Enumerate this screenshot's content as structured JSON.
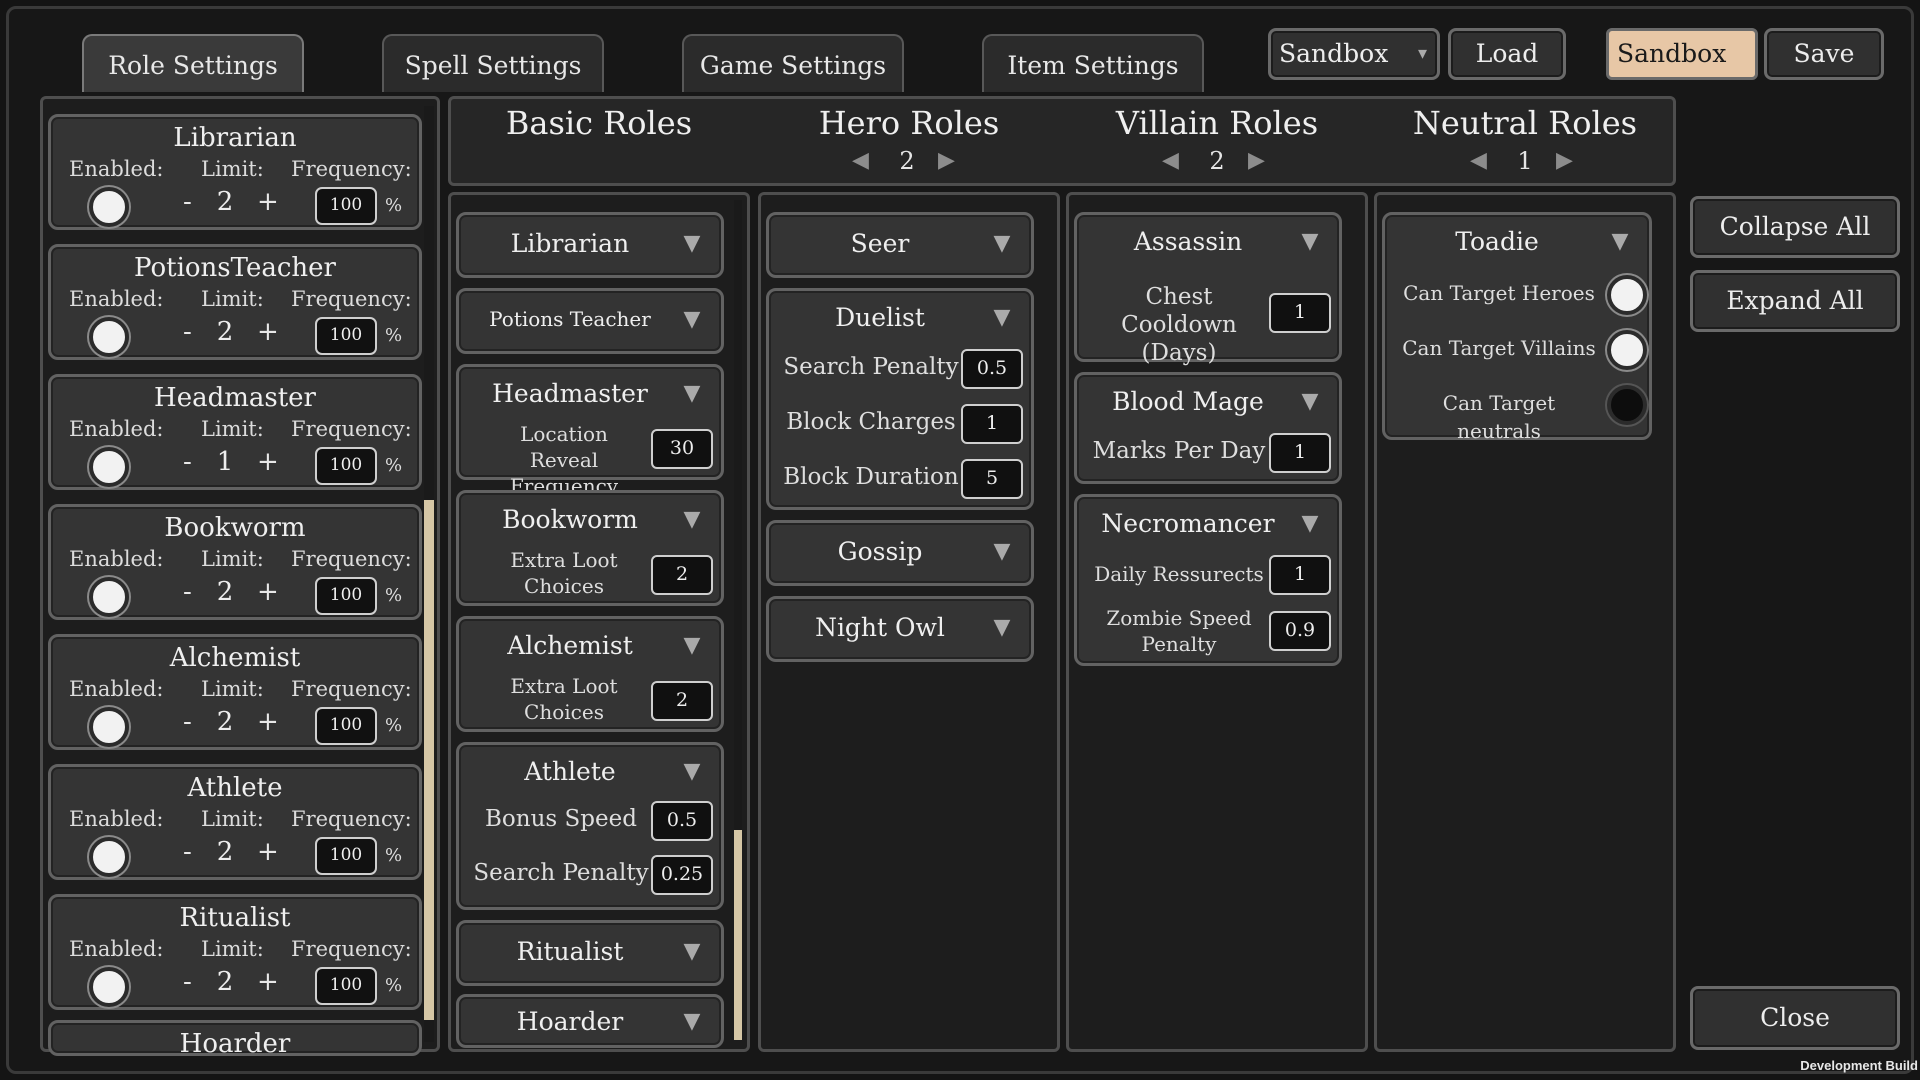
{
  "tabs": [
    "Role Settings",
    "Spell Settings",
    "Game Settings",
    "Item Settings"
  ],
  "top_controls": {
    "preset_dropdown": "Sandbox",
    "load_label": "Load",
    "preset_name_input": "Sandbox",
    "save_label": "Save"
  },
  "left_panel": {
    "labels": {
      "enabled": "Enabled:",
      "limit": "Limit:",
      "frequency": "Frequency:",
      "minus": "-",
      "plus": "+",
      "percent": "%"
    },
    "roles": [
      {
        "name": "Librarian",
        "enabled": true,
        "limit": "2",
        "frequency": "100"
      },
      {
        "name": "PotionsTeacher",
        "enabled": true,
        "limit": "2",
        "frequency": "100"
      },
      {
        "name": "Headmaster",
        "enabled": true,
        "limit": "1",
        "frequency": "100"
      },
      {
        "name": "Bookworm",
        "enabled": true,
        "limit": "2",
        "frequency": "100"
      },
      {
        "name": "Alchemist",
        "enabled": true,
        "limit": "2",
        "frequency": "100"
      },
      {
        "name": "Athlete",
        "enabled": true,
        "limit": "2",
        "frequency": "100"
      },
      {
        "name": "Ritualist",
        "enabled": true,
        "limit": "2",
        "frequency": "100"
      }
    ],
    "partial_role": "Hoarder"
  },
  "columns": {
    "basic": {
      "title": "Basic Roles"
    },
    "hero": {
      "title": "Hero Roles",
      "count": "2"
    },
    "villain": {
      "title": "Villain Roles",
      "count": "2"
    },
    "neutral": {
      "title": "Neutral Roles",
      "count": "1"
    }
  },
  "basic_roles": {
    "librarian": "Librarian",
    "potions_teacher": "Potions Teacher",
    "headmaster": {
      "name": "Headmaster",
      "param": "Location Reveal Frequency",
      "value": "30"
    },
    "bookworm": {
      "name": "Bookworm",
      "param": "Extra Loot Choices",
      "value": "2"
    },
    "alchemist": {
      "name": "Alchemist",
      "param": "Extra Loot Choices",
      "value": "2"
    },
    "athlete": {
      "name": "Athlete",
      "p1": "Bonus Speed",
      "v1": "0.5",
      "p2": "Search Penalty",
      "v2": "0.25"
    },
    "ritualist": "Ritualist",
    "hoarder": "Hoarder"
  },
  "hero_roles": {
    "seer": "Seer",
    "duelist": {
      "name": "Duelist",
      "p1": "Search Penalty",
      "v1": "0.5",
      "p2": "Block Charges",
      "v2": "1",
      "p3": "Block Duration",
      "v3": "5"
    },
    "gossip": "Gossip",
    "night_owl": "Night Owl"
  },
  "villain_roles": {
    "assassin": {
      "name": "Assassin",
      "param": "Chest Cooldown (Days)",
      "value": "1"
    },
    "blood_mage": {
      "name": "Blood Mage",
      "param": "Marks Per Day",
      "value": "1"
    },
    "necromancer": {
      "name": "Necromancer",
      "p1": "Daily Ressurects",
      "v1": "1",
      "p2": "Zombie Speed Penalty",
      "v2": "0.9"
    }
  },
  "neutral_roles": {
    "toadie": {
      "name": "Toadie",
      "options": [
        {
          "label": "Can Target Heroes",
          "on": true
        },
        {
          "label": "Can Target Villains",
          "on": true
        },
        {
          "label": "Can Target neutrals",
          "on": false
        }
      ]
    }
  },
  "side_buttons": {
    "collapse_all": "Collapse All",
    "expand_all": "Expand All",
    "close": "Close"
  },
  "footer": "Development Build"
}
